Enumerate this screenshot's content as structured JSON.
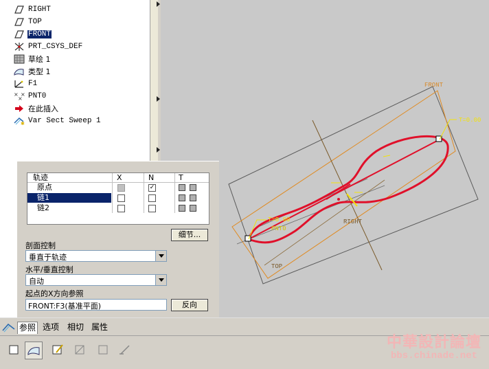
{
  "model_tree": {
    "items": [
      {
        "label": "RIGHT",
        "icon": "datum-plane-icon"
      },
      {
        "label": "TOP",
        "icon": "datum-plane-icon"
      },
      {
        "label": "FRONT",
        "icon": "datum-plane-icon",
        "selected": true
      },
      {
        "label": "PRT_CSYS_DEF",
        "icon": "csys-icon"
      },
      {
        "label": "草绘 1",
        "icon": "sketch-icon"
      },
      {
        "label": "类型 1",
        "icon": "surface-icon"
      },
      {
        "label": "F1",
        "icon": "datum-axis-icon"
      },
      {
        "label": "PNT0",
        "icon": "datum-point-icon"
      },
      {
        "label": "在此插入",
        "icon": "insert-here-icon"
      },
      {
        "label": "Var Sect Sweep 1",
        "icon": "var-sect-sweep-icon"
      }
    ]
  },
  "references_panel": {
    "trajectory_table": {
      "headers": {
        "name": "轨迹",
        "x": "X",
        "n": "N",
        "t": "T"
      },
      "rows": [
        {
          "name": "原点",
          "x_disabled": true,
          "n_checked": true
        },
        {
          "name": "链1",
          "selected": true
        },
        {
          "name": "链2"
        }
      ]
    },
    "details_button": "细节...",
    "section_control_label": "剖面控制",
    "section_control_value": "垂直于轨迹",
    "hv_control_label": "水平/垂直控制",
    "hv_control_value": "自动",
    "x_dir_ref_label": "起点的X方向参照",
    "x_dir_ref_value": "FRONT:F3(基准平面)",
    "flip_button": "反向"
  },
  "tabs": [
    "参照",
    "选项",
    "相切",
    "属性"
  ],
  "active_tab": "参照",
  "viewport": {
    "plane_labels": {
      "front": "FRONT",
      "right": "RIGHT",
      "top": "TOP"
    },
    "point_label": "PNT0",
    "t_start": "T=0.00",
    "t_end": "T=0.00"
  },
  "colors": {
    "trajectory": "#e0102a",
    "annotation": "#f2e20a",
    "datum_plane": "#d88a2a",
    "selection": "#0a246a"
  },
  "watermark": {
    "line1": "中華設計論壇",
    "line2": "bbs.chinade.net"
  }
}
